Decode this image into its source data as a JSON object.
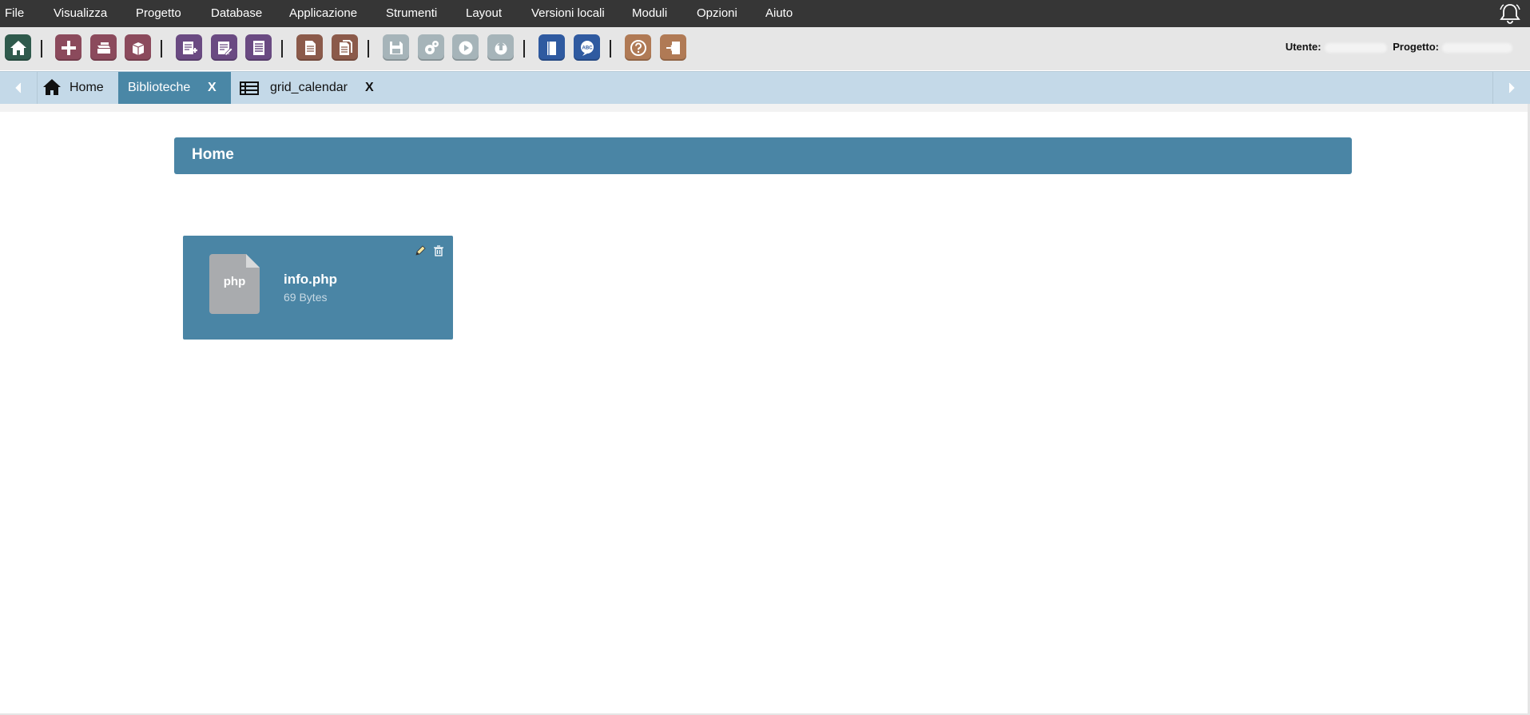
{
  "menu": [
    "File",
    "Visualizza",
    "Progetto",
    "Database",
    "Applicazione",
    "Strumenti",
    "Layout",
    "Versioni locali",
    "Moduli",
    "Opzioni",
    "Aiuto"
  ],
  "toolbar": {
    "buttons": [
      {
        "icon": "home-icon",
        "color": "#2f5a4c"
      },
      {
        "icon": "add-icon",
        "color": "#8b4a5c"
      },
      {
        "icon": "open-folder-icon",
        "color": "#8b4a5c"
      },
      {
        "icon": "box-icon",
        "color": "#8b4a5c"
      },
      {
        "icon": "new-form-icon",
        "color": "#6a4a82"
      },
      {
        "icon": "edit-form-icon",
        "color": "#6a4a82"
      },
      {
        "icon": "list-form-icon",
        "color": "#6a4a82"
      },
      {
        "icon": "document-icon",
        "color": "#8b5a4a"
      },
      {
        "icon": "documents-icon",
        "color": "#8b5a4a"
      },
      {
        "icon": "save-icon",
        "color": "#a6b4b9"
      },
      {
        "icon": "settings-icon",
        "color": "#a6b4b9"
      },
      {
        "icon": "play-icon",
        "color": "#a6b4b9"
      },
      {
        "icon": "publish-icon",
        "color": "#a6b4b9"
      },
      {
        "icon": "book-icon",
        "color": "#2f5aa0"
      },
      {
        "icon": "spellcheck-icon",
        "color": "#2f5aa0"
      },
      {
        "icon": "help-icon",
        "color": "#b07a55"
      },
      {
        "icon": "exit-icon",
        "color": "#b07a55"
      }
    ],
    "user_label": "Utente:",
    "project_label": "Progetto:"
  },
  "tabs": [
    {
      "label": "Home",
      "icon": "home-icon",
      "closable": false,
      "active": false
    },
    {
      "label": "Biblioteche",
      "closable": true,
      "active": true
    },
    {
      "label": "grid_calendar",
      "icon": "table-icon",
      "closable": true,
      "active": false
    }
  ],
  "tab_close_label": "X",
  "panel": {
    "title": "Home"
  },
  "files": [
    {
      "name": "info.php",
      "size": "69 Bytes",
      "type": "php"
    }
  ],
  "colors": {
    "accent": "#4a85a5",
    "menubar": "#363636",
    "tabbar": "#c4d9e8"
  }
}
